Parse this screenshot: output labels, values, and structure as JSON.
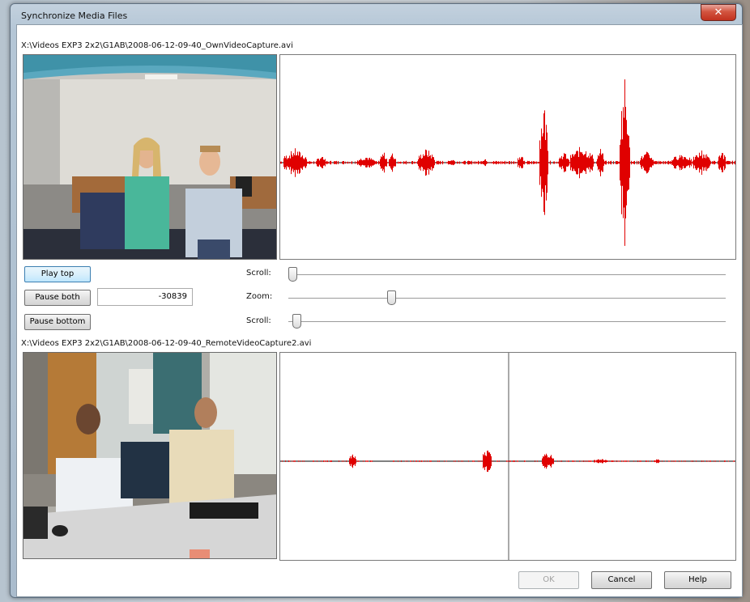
{
  "window": {
    "title": "Synchronize Media Files",
    "close_symbol": "✕"
  },
  "top": {
    "path": "X:\\Videos EXP3 2x2\\G1AB\\2008-06-12-09-40_OwnVideoCapture.avi"
  },
  "bottom": {
    "path": "X:\\Videos EXP3 2x2\\G1AB\\2008-06-12-09-40_RemoteVideoCapture2.avi"
  },
  "controls": {
    "play_top": "Play top",
    "pause_both": "Pause both",
    "pause_bottom": "Pause bottom",
    "offset_value": "-30839",
    "scroll_label": "Scroll:",
    "zoom_label": "Zoom:",
    "scroll_top_position": 0.0,
    "zoom_position": 0.23,
    "scroll_bottom_position": 0.01
  },
  "footer": {
    "ok": "OK",
    "cancel": "Cancel",
    "help": "Help"
  },
  "colors": {
    "waveform": "#e00000",
    "baseline": "#000000",
    "accent": "#3c7fb1"
  }
}
